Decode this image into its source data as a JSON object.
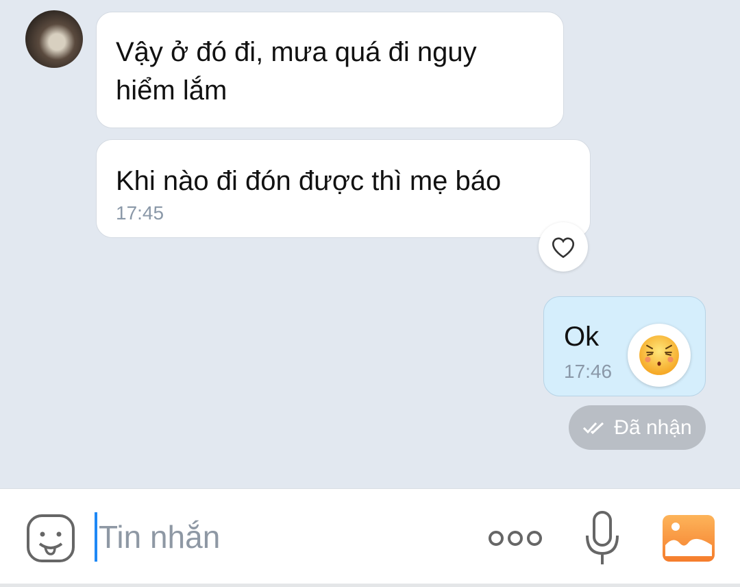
{
  "messages": [
    {
      "side": "received",
      "text": "Vậy ở đó đi, mưa quá đi nguy hiểm lắm"
    },
    {
      "side": "received",
      "text": "Khi nào đi đón được thì mẹ báo",
      "time": "17:45"
    },
    {
      "side": "sent",
      "text": "Ok",
      "time": "17:46",
      "status": "Đã nhận"
    }
  ],
  "composer": {
    "placeholder": "Tin nhắn"
  },
  "colors": {
    "background": "#e2e8f0",
    "sent_bubble": "#d5eefc",
    "caret": "#1e88f5",
    "photo_icon": "#f7913a"
  }
}
